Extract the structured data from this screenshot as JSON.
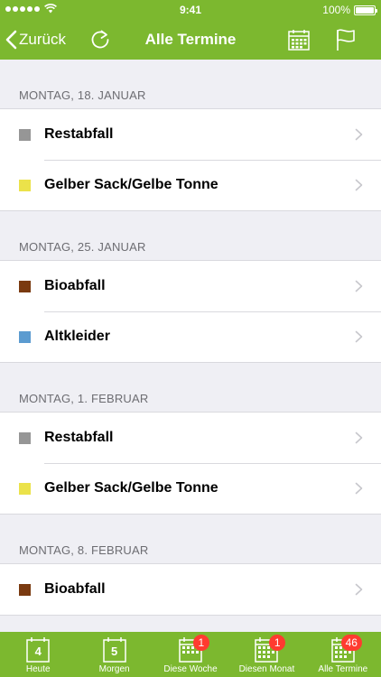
{
  "status_bar": {
    "time": "9:41",
    "battery": "100%"
  },
  "nav": {
    "back_label": "Zurück",
    "title": "Alle Termine"
  },
  "sections": [
    {
      "header": "MONTAG, 18. JANUAR",
      "items": [
        {
          "label": "Restabfall",
          "color": "#969696"
        },
        {
          "label": "Gelber Sack/Gelbe Tonne",
          "color": "#ebe24a"
        }
      ]
    },
    {
      "header": "MONTAG, 25. JANUAR",
      "items": [
        {
          "label": "Bioabfall",
          "color": "#7a3a10"
        },
        {
          "label": "Altkleider",
          "color": "#5b9bd0"
        }
      ]
    },
    {
      "header": "MONTAG, 1. FEBRUAR",
      "items": [
        {
          "label": "Restabfall",
          "color": "#969696"
        },
        {
          "label": "Gelber Sack/Gelbe Tonne",
          "color": "#ebe24a"
        }
      ]
    },
    {
      "header": "MONTAG, 8. FEBRUAR",
      "items": [
        {
          "label": "Bioabfall",
          "color": "#7a3a10"
        }
      ]
    }
  ],
  "tabs": [
    {
      "label": "Heute",
      "icon": "calendar-day-icon",
      "day": "4",
      "badge": ""
    },
    {
      "label": "Morgen",
      "icon": "calendar-day-icon",
      "day": "5",
      "badge": ""
    },
    {
      "label": "Diese Woche",
      "icon": "calendar-week-icon",
      "day": "",
      "badge": "1"
    },
    {
      "label": "Diesen Monat",
      "icon": "calendar-month-icon",
      "day": "",
      "badge": "1"
    },
    {
      "label": "Alle Termine",
      "icon": "calendar-all-icon",
      "day": "",
      "badge": "46"
    }
  ],
  "colors": {
    "brand": "#7cb82f",
    "badge": "#ff3b30"
  }
}
